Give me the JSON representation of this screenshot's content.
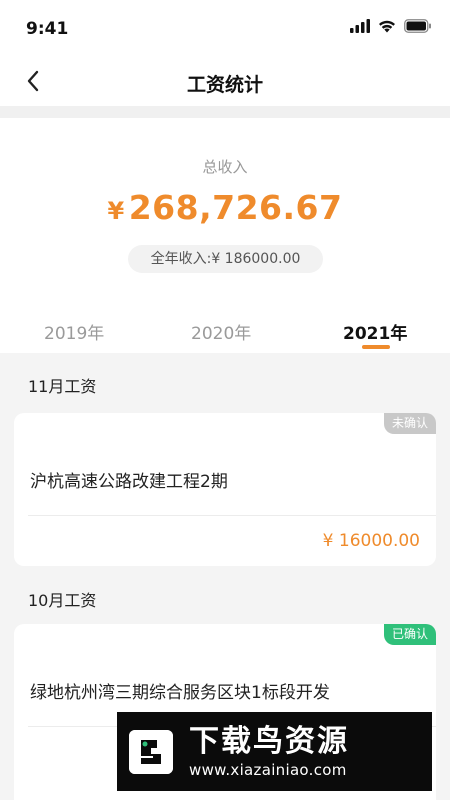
{
  "status": {
    "time": "9:41"
  },
  "nav": {
    "title": "工资统计"
  },
  "summary": {
    "total_label": "总收入",
    "currency": "¥",
    "total_amount": "268,726.67",
    "annual_label": "全年收入:",
    "annual_value": "¥ 186000.00"
  },
  "year_tabs": [
    {
      "label": "2019年",
      "active": false
    },
    {
      "label": "2020年",
      "active": false
    },
    {
      "label": "2021年",
      "active": true
    }
  ],
  "months": [
    {
      "label": "11月工资",
      "status": "未确认",
      "status_color": "#c8c8c8",
      "project": "沪杭高速公路改建工程2期",
      "amount": "¥ 16000.00"
    },
    {
      "label": "10月工资",
      "status": "已确认",
      "status_color": "#2fc07a",
      "project": "绿地杭州湾三期综合服务区块1标段开发",
      "amount": ""
    }
  ],
  "theme": {
    "accent": "#ef8b2c",
    "confirmed": "#2fc07a",
    "unconfirmed": "#c8c8c8"
  },
  "watermark": {
    "title": "下载鸟资源",
    "url": "www.xiazainiao.com"
  }
}
